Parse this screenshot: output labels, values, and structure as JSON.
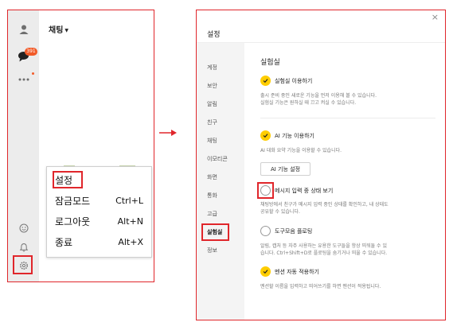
{
  "left_panel": {
    "chat_title": "채팅",
    "badge_count": "391",
    "menu_items": [
      {
        "label": "설정",
        "shortcut": ""
      },
      {
        "label": "잠금모드",
        "shortcut": "Ctrl+L"
      },
      {
        "label": "로그아웃",
        "shortcut": "Alt+N"
      },
      {
        "label": "종료",
        "shortcut": "Alt+X"
      }
    ]
  },
  "settings": {
    "title": "설정",
    "nav": [
      "계정",
      "보안",
      "알림",
      "친구",
      "채팅",
      "이모티콘",
      "화면",
      "통화",
      "고급",
      "실험실",
      "정보"
    ],
    "active_nav": "실험실",
    "heading": "실험실",
    "options": {
      "lab_enable": {
        "label": "실험실 이용하기",
        "desc_line1": "출시 준비 중인 새로운 기능을 먼저 이용해 볼 수 있습니다.",
        "desc_line2": "실험실 기능은 원하실 때 끄고 켜실 수 있습니다.",
        "checked": true
      },
      "ai_enable": {
        "label": "AI 기능 이용하기",
        "desc": "AI 대화 요약 기능을 이용할 수 있습니다.",
        "checked": true,
        "button": "AI 기능 설정"
      },
      "typing_status": {
        "label": "메시지 입력 중 상태 보기",
        "desc_line1": "채팅방에서 친구가 메시지 입력 중인 상태를 확인하고, 내 상태도",
        "desc_line2": "공유할 수 있습니다.",
        "checked": false
      },
      "toolbox": {
        "label": "도구모음 플로팅",
        "desc_line1": "알림, 캡처 등 자주 사용하는 유용한 도구들을 항상 띄워둘 수 있",
        "desc_line2": "습니다. Ctrl+Shift+D로 플로팅을 숨기거나 띄울 수 있습니다.",
        "checked": false
      },
      "auto_mention": {
        "label": "멘션 자동 적용하기",
        "desc": "멘션할 이름을 입력하고 띄어쓰기를 하면 멘션이 적용됩니다.",
        "checked": true
      }
    },
    "close_glyph": "×"
  },
  "colors": {
    "highlight": "#e0262b",
    "check_on": "#ffcd00",
    "badge": "#f25b29"
  }
}
